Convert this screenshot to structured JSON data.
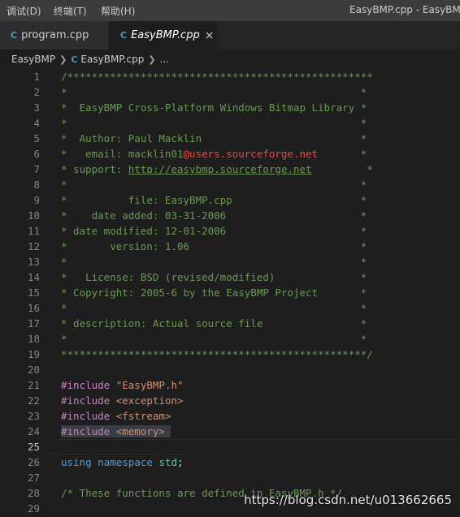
{
  "menubar": {
    "items": [
      "调试(D)",
      "终端(T)",
      "帮助(H)"
    ],
    "window_title": "EasyBMP.cpp - EasyBMP"
  },
  "tabs": [
    {
      "icon": "C",
      "label": "program.cpp",
      "active": false
    },
    {
      "icon": "C",
      "label": "EasyBMP.cpp",
      "active": true,
      "close": "×"
    }
  ],
  "breadcrumb": {
    "folder": "EasyBMP",
    "file_icon": "C",
    "file": "EasyBMP.cpp",
    "more": "..."
  },
  "editor": {
    "current_line": 25,
    "lines": [
      {
        "n": "1",
        "segs": [
          {
            "t": "/**************************************************",
            "c": "comment"
          }
        ]
      },
      {
        "n": "2",
        "segs": [
          {
            "t": "*                                                *",
            "c": "comment"
          }
        ]
      },
      {
        "n": "3",
        "segs": [
          {
            "t": "*  EasyBMP Cross-Platform Windows Bitmap Library *",
            "c": "comment"
          }
        ]
      },
      {
        "n": "4",
        "segs": [
          {
            "t": "*                                                *",
            "c": "comment"
          }
        ]
      },
      {
        "n": "5",
        "segs": [
          {
            "t": "*  Author: Paul Macklin                          *",
            "c": "comment"
          }
        ]
      },
      {
        "n": "6",
        "segs": [
          {
            "t": "*   email: macklin01",
            "c": "comment"
          },
          {
            "t": "@users.sourceforge.net",
            "c": "email"
          },
          {
            "t": "       *",
            "c": "comment"
          }
        ]
      },
      {
        "n": "7",
        "segs": [
          {
            "t": "* support: ",
            "c": "comment"
          },
          {
            "t": "http://easybmp.sourceforge.net",
            "c": "link"
          },
          {
            "t": "         *",
            "c": "comment"
          }
        ]
      },
      {
        "n": "8",
        "segs": [
          {
            "t": "*                                                *",
            "c": "comment"
          }
        ]
      },
      {
        "n": "9",
        "segs": [
          {
            "t": "*          file: EasyBMP.cpp                     *",
            "c": "comment"
          }
        ]
      },
      {
        "n": "10",
        "segs": [
          {
            "t": "*    date added: 03-31-2006                      *",
            "c": "comment"
          }
        ]
      },
      {
        "n": "11",
        "segs": [
          {
            "t": "* date modified: 12-01-2006                      *",
            "c": "comment"
          }
        ]
      },
      {
        "n": "12",
        "segs": [
          {
            "t": "*       version: 1.06                            *",
            "c": "comment"
          }
        ]
      },
      {
        "n": "13",
        "segs": [
          {
            "t": "*                                                *",
            "c": "comment"
          }
        ]
      },
      {
        "n": "14",
        "segs": [
          {
            "t": "*   License: BSD (revised/modified)              *",
            "c": "comment"
          }
        ]
      },
      {
        "n": "15",
        "segs": [
          {
            "t": "* Copyright: 2005-6 by the EasyBMP Project       *",
            "c": "comment"
          }
        ]
      },
      {
        "n": "16",
        "segs": [
          {
            "t": "*                                                *",
            "c": "comment"
          }
        ]
      },
      {
        "n": "17",
        "segs": [
          {
            "t": "* description: Actual source file                *",
            "c": "comment"
          }
        ]
      },
      {
        "n": "18",
        "segs": [
          {
            "t": "*                                                *",
            "c": "comment"
          }
        ]
      },
      {
        "n": "19",
        "segs": [
          {
            "t": "**************************************************/",
            "c": "comment"
          }
        ]
      },
      {
        "n": "20",
        "segs": []
      },
      {
        "n": "21",
        "segs": [
          {
            "t": "#include ",
            "c": "directive"
          },
          {
            "t": "\"EasyBMP.h\"",
            "c": "string"
          }
        ]
      },
      {
        "n": "22",
        "segs": [
          {
            "t": "#include ",
            "c": "directive"
          },
          {
            "t": "<exception>",
            "c": "string"
          }
        ]
      },
      {
        "n": "23",
        "segs": [
          {
            "t": "#include ",
            "c": "directive"
          },
          {
            "t": "<fstream>",
            "c": "string"
          }
        ]
      },
      {
        "n": "24",
        "segs": [
          {
            "t": "#include ",
            "c": "directive",
            "hl": true
          },
          {
            "t": "<memory>",
            "c": "string",
            "hl": true
          },
          {
            "t": " ",
            "c": "plain",
            "hl": true
          }
        ]
      },
      {
        "n": "25",
        "segs": []
      },
      {
        "n": "26",
        "segs": [
          {
            "t": "using",
            "c": "keyword"
          },
          {
            "t": " ",
            "c": "plain"
          },
          {
            "t": "namespace",
            "c": "keyword"
          },
          {
            "t": " ",
            "c": "plain"
          },
          {
            "t": "std",
            "c": "ns"
          },
          {
            "t": ";",
            "c": "plain"
          }
        ]
      },
      {
        "n": "27",
        "segs": []
      },
      {
        "n": "28",
        "segs": [
          {
            "t": "/* These functions are defined in EasyBMP.h */",
            "c": "comment"
          }
        ]
      },
      {
        "n": "29",
        "segs": []
      }
    ]
  },
  "watermark": "https://blog.csdn.net/u013662665",
  "colors": {
    "background": "#1e1e1e",
    "comment": "#6a9955",
    "directive": "#c586c0",
    "string": "#ce9178",
    "keyword": "#569cd6",
    "namespace": "#4ec9b0",
    "file_icon": "#519aba"
  }
}
